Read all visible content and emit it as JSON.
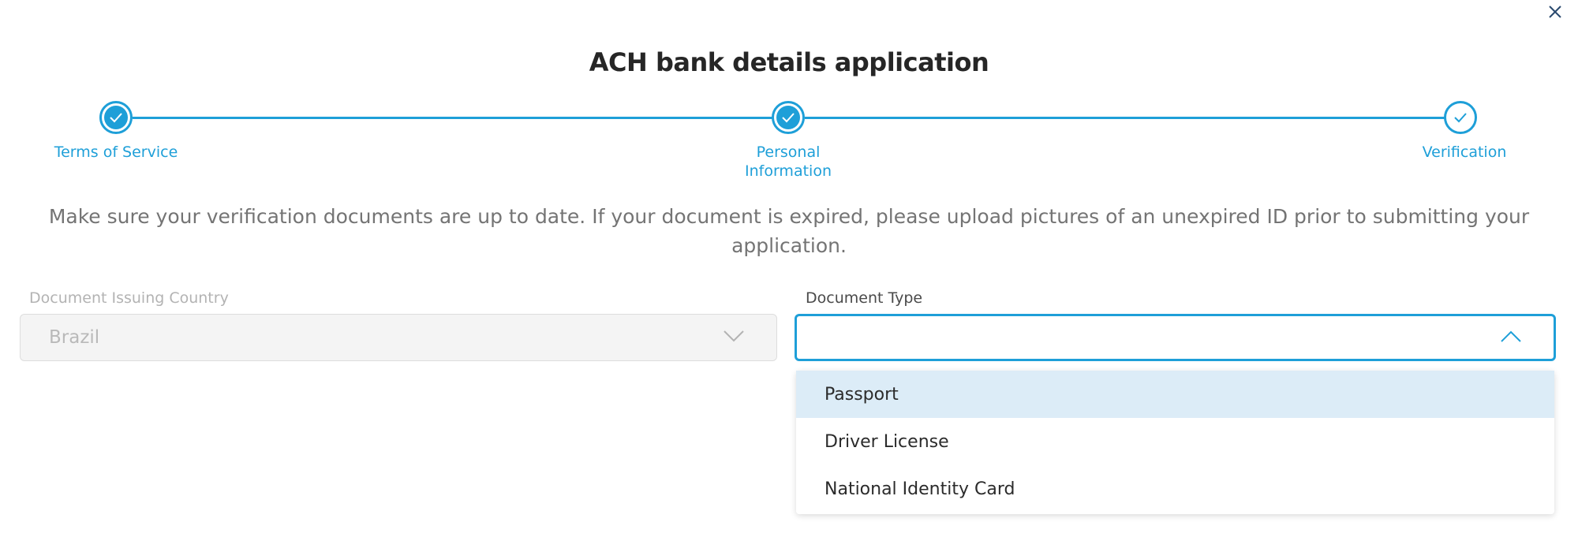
{
  "modal": {
    "title": "ACH bank details application",
    "close_icon": "close-icon"
  },
  "stepper": {
    "steps": [
      {
        "label": "Terms of Service",
        "status": "completed"
      },
      {
        "label": "Personal Information",
        "status": "completed"
      },
      {
        "label": "Verification",
        "status": "current"
      }
    ],
    "accent_color": "#1e9fd8"
  },
  "notice": "Make sure your verification documents are up to date. If your document is expired, please upload pictures of an unexpired ID prior to submitting your application.",
  "fields": {
    "country": {
      "label": "Document Issuing Country",
      "value": "Brazil",
      "disabled": true
    },
    "document_type": {
      "label": "Document Type",
      "value": "",
      "open": true,
      "options": [
        "Passport",
        "Driver License",
        "National Identity Card"
      ],
      "highlighted": "Passport"
    }
  }
}
